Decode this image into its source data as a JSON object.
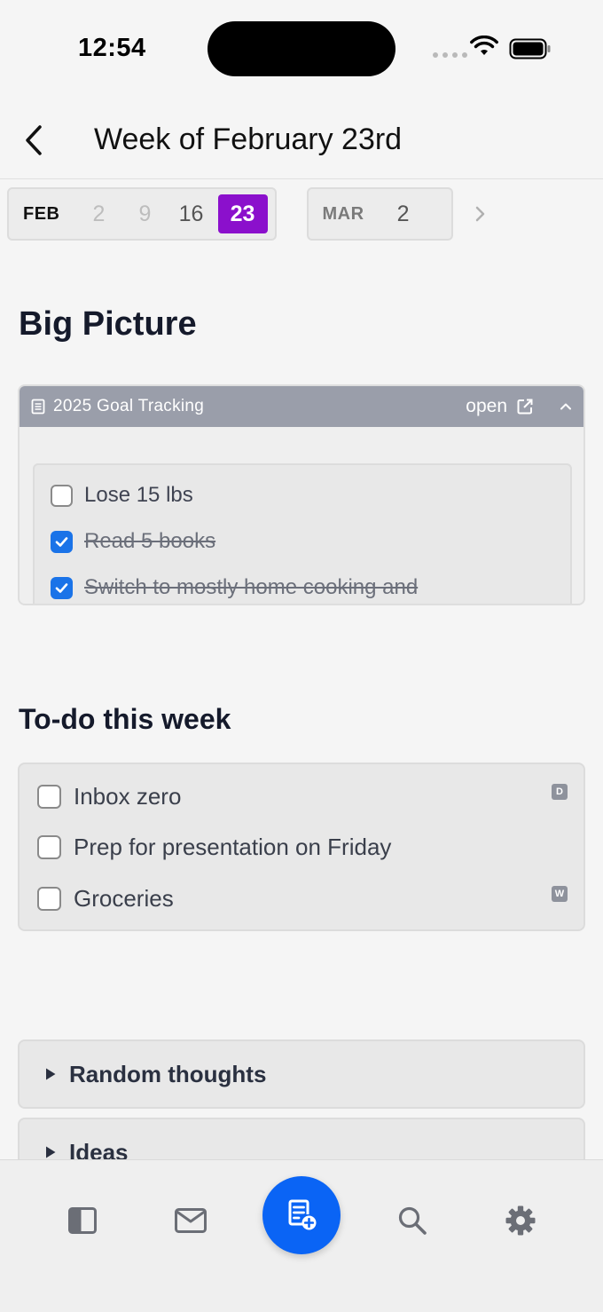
{
  "status_bar": {
    "time": "12:54"
  },
  "header": {
    "title": "Week of February 23rd"
  },
  "week_selector": {
    "months": [
      {
        "label": "FEB",
        "days": [
          "2",
          "9",
          "16",
          "23"
        ],
        "selected": "23"
      },
      {
        "label": "MAR",
        "days": [
          "2"
        ]
      }
    ]
  },
  "big_picture": {
    "title": "Big Picture",
    "embed": {
      "doc_title": "2025 Goal Tracking",
      "open_label": "open",
      "items": [
        {
          "text": "Lose 15 lbs",
          "checked": false
        },
        {
          "text": "Read 5 books",
          "checked": true
        },
        {
          "text": "Switch to mostly home cooking and",
          "checked": true
        }
      ]
    }
  },
  "todo": {
    "title": "To-do this week",
    "items": [
      {
        "text": "Inbox zero",
        "tag": "D"
      },
      {
        "text": "Prep for presentation on Friday",
        "tag": ""
      },
      {
        "text": "Groceries",
        "tag": "W"
      }
    ]
  },
  "toggles": [
    {
      "label": "Random thoughts"
    },
    {
      "label": "Ideas"
    }
  ],
  "tabbar": {
    "tabs": [
      "sidebar-icon",
      "mail-icon",
      "new-note-icon",
      "search-icon",
      "settings-icon"
    ]
  },
  "colors": {
    "accent_purple": "#8b10cc",
    "accent_blue": "#0a64f5",
    "checkbox_blue": "#1a73e8",
    "embed_header": "#9a9eaa"
  }
}
